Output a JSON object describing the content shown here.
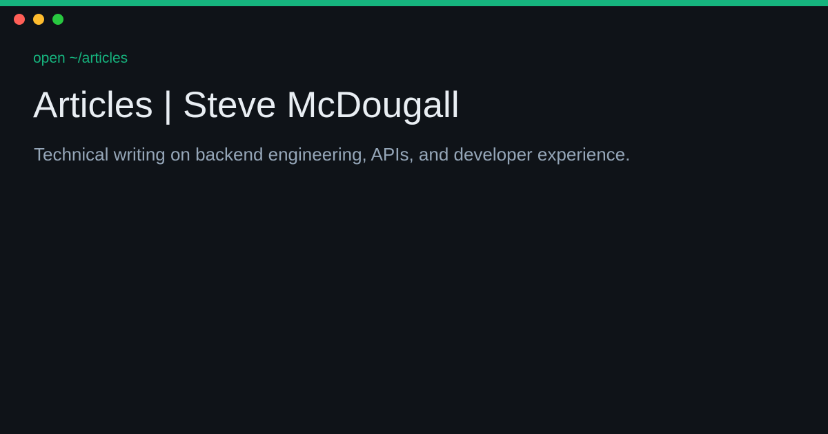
{
  "accent_color": "#16b47e",
  "window_controls": {
    "close_color": "#ff5f57",
    "minimize_color": "#febc2e",
    "maximize_color": "#28c840"
  },
  "command": "open ~/articles",
  "title": "Articles | Steve McDougall",
  "subtitle": "Technical writing on backend engineering, APIs, and developer experience."
}
